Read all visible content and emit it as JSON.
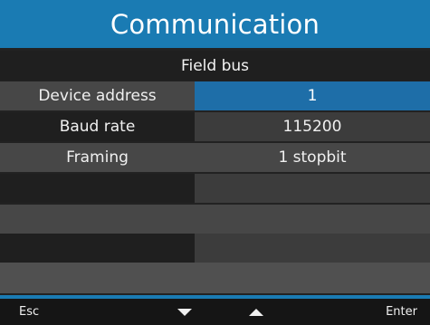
{
  "header": {
    "title": "Communication",
    "accent_color": "#1a7bb3"
  },
  "section": {
    "title": "Field bus"
  },
  "settings": [
    {
      "label": "Device address",
      "value": "1",
      "selected": true
    },
    {
      "label": "Baud rate",
      "value": "115200",
      "selected": false
    },
    {
      "label": "Framing",
      "value": "1 stopbit",
      "selected": false
    },
    {
      "label": "",
      "value": "",
      "selected": false
    },
    {
      "label": "",
      "value": "",
      "selected": false
    },
    {
      "label": "",
      "value": "",
      "selected": false
    },
    {
      "label": "",
      "value": "",
      "selected": false
    }
  ],
  "footer": {
    "esc_label": "Esc",
    "enter_label": "Enter",
    "down_icon": "triangle-down-icon",
    "up_icon": "triangle-up-icon"
  },
  "colors": {
    "selected_value_bg": "#1e6ea8"
  }
}
